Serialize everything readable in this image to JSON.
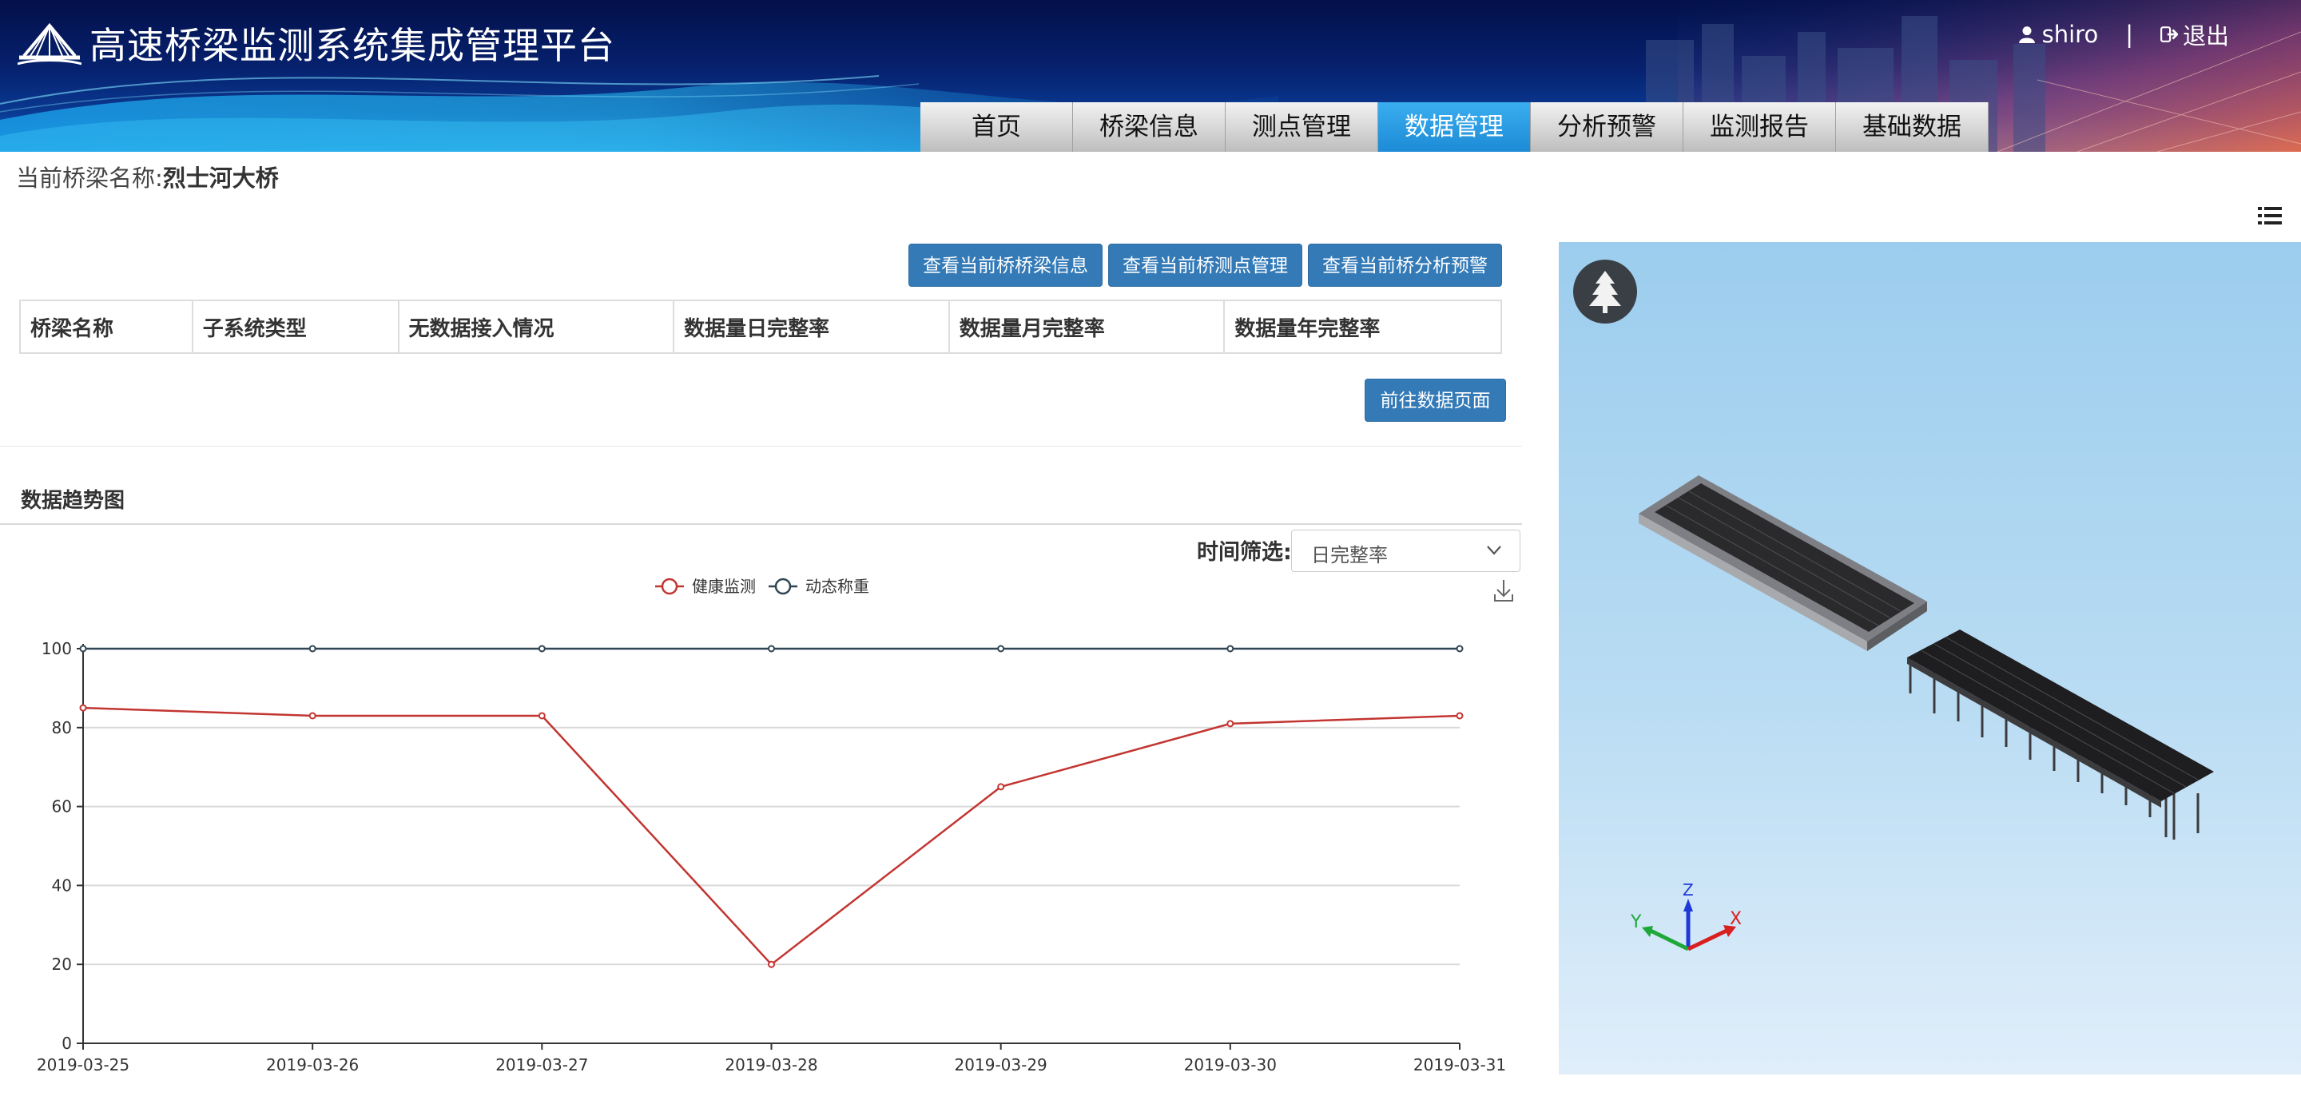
{
  "header": {
    "app_title": "高速桥梁监测系统集成管理平台",
    "user": {
      "name": "shiro",
      "separator": "|",
      "logout_label": "退出"
    },
    "nav": [
      {
        "label": "首页",
        "active": false
      },
      {
        "label": "桥梁信息",
        "active": false
      },
      {
        "label": "测点管理",
        "active": false
      },
      {
        "label": "数据管理",
        "active": true
      },
      {
        "label": "分析预警",
        "active": false
      },
      {
        "label": "监测报告",
        "active": false
      },
      {
        "label": "基础数据",
        "active": false
      }
    ]
  },
  "current_bridge": {
    "prefix": "当前桥梁名称:",
    "name": "烈士河大桥"
  },
  "actions": {
    "view_bridge_info": "查看当前桥桥梁信息",
    "view_point_manage": "查看当前桥测点管理",
    "view_analysis_warning": "查看当前桥分析预警",
    "goto_data_page": "前往数据页面"
  },
  "summary_table": {
    "columns": [
      "桥梁名称",
      "子系统类型",
      "无数据接入情况",
      "数据量日完整率",
      "数据量月完整率",
      "数据量年完整率"
    ],
    "rows": []
  },
  "trend": {
    "section_title": "数据趋势图",
    "filter_label": "时间筛选:",
    "filter_value": "日完整率",
    "icons": [
      "download-icon",
      "chevron-down-icon",
      "list-icon",
      "tree-icon",
      "user-icon",
      "logout-icon",
      "bridge-logo-icon"
    ]
  },
  "colors": {
    "accent": "#337ab7",
    "nav_active": "#1d8bd6",
    "series_health": "#c23531",
    "series_weigh": "#2f4554"
  },
  "chart_data": {
    "type": "line",
    "title": "",
    "xlabel": "",
    "ylabel": "",
    "x": [
      "2019-03-25",
      "2019-03-26",
      "2019-03-27",
      "2019-03-28",
      "2019-03-29",
      "2019-03-30",
      "2019-03-31"
    ],
    "series": [
      {
        "name": "健康监测",
        "values": [
          85,
          83,
          83,
          20,
          65,
          81,
          83
        ],
        "color": "#c23531"
      },
      {
        "name": "动态称重",
        "values": [
          100,
          100,
          100,
          100,
          100,
          100,
          100
        ],
        "color": "#2f4554"
      }
    ],
    "yticks": [
      0,
      20,
      40,
      60,
      80,
      100
    ],
    "ylim": [
      0,
      100
    ],
    "grid": true,
    "legend": "top-center"
  }
}
